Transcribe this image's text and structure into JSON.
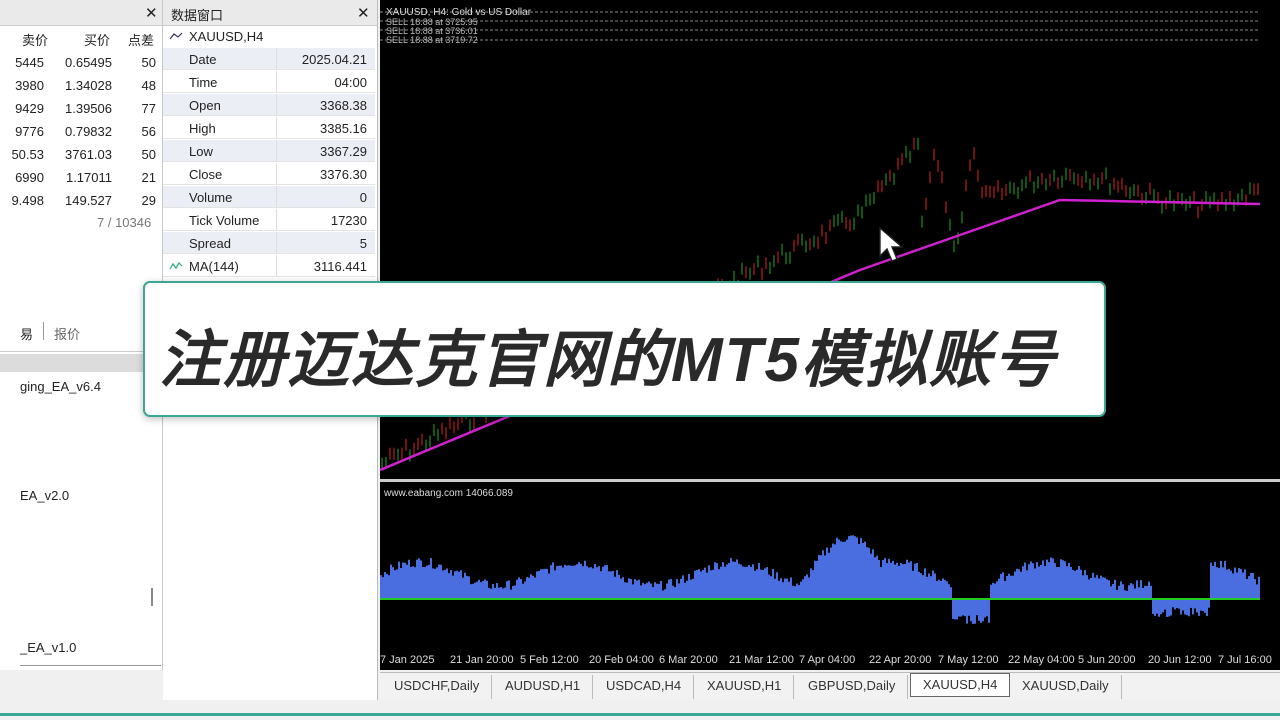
{
  "market_watch": {
    "columns": [
      "卖价",
      "买价",
      "点差"
    ],
    "rows": [
      {
        "bid": "5445",
        "ask": "0.65495",
        "spread": "50"
      },
      {
        "bid": "3980",
        "ask": "1.34028",
        "spread": "48"
      },
      {
        "bid": "9429",
        "ask": "1.39506",
        "spread": "77"
      },
      {
        "bid": "9776",
        "ask": "0.79832",
        "spread": "56"
      },
      {
        "bid": "50.53",
        "ask": "3761.03",
        "spread": "50"
      },
      {
        "bid": "6990",
        "ask": "1.17011",
        "spread": "21"
      },
      {
        "bid": "9.498",
        "ask": "149.527",
        "spread": "29"
      }
    ],
    "count": "7 / 10346"
  },
  "navigator": {
    "tabs": [
      "易",
      "报价"
    ],
    "items": [
      "ging_EA_v6.4",
      "EA_v2.0",
      "_EA_v1.0"
    ]
  },
  "data_window": {
    "title": "数据窗口",
    "symbol": "XAUUSD,H4",
    "rows": [
      {
        "key": "Date",
        "value": "2025.04.21"
      },
      {
        "key": "Time",
        "value": "04:00"
      },
      {
        "key": "Open",
        "value": "3368.38"
      },
      {
        "key": "High",
        "value": "3385.16"
      },
      {
        "key": "Low",
        "value": "3367.29"
      },
      {
        "key": "Close",
        "value": "3376.30"
      },
      {
        "key": "Volume",
        "value": "0"
      },
      {
        "key": "Tick Volume",
        "value": "17230"
      },
      {
        "key": "Spread",
        "value": "5"
      },
      {
        "key": "MA(144)",
        "value": "3116.441"
      }
    ]
  },
  "chart": {
    "header": "XAUUSD, H4: Gold vs US Dollar",
    "sell_orders": [
      "SELL 18.88 at 3725.95",
      "SELL 18.88 at 3736.01",
      "SELL 18.88 at 3719.72"
    ],
    "indicator_label": "www.eabang.com 14066.089",
    "x_labels": [
      "7 Jan 2025",
      "21 Jan 20:00",
      "5 Feb 12:00",
      "20 Feb 04:00",
      "6 Mar 20:00",
      "21 Mar 12:00",
      "7 Apr 04:00",
      "22 Apr 20:00",
      "7 May 12:00",
      "22 May 04:00",
      "5 Jun 20:00",
      "20 Jun 12:00",
      "7 Jul 16:00"
    ],
    "colors": {
      "ma": "#d020d0",
      "histogram": "#4a6ee0",
      "zero_line": "#22cc22",
      "up": "#22aa22",
      "down": "#dd2222"
    }
  },
  "tabs": {
    "items": [
      "USDCHF,Daily",
      "AUDUSD,H1",
      "USDCAD,H4",
      "XAUUSD,H1",
      "GBPUSD,Daily",
      "XAUUSD,H4",
      "XAUUSD,Daily"
    ],
    "active": "XAUUSD,H4"
  },
  "caption": "注册迈达克官网的MT5模拟账号"
}
